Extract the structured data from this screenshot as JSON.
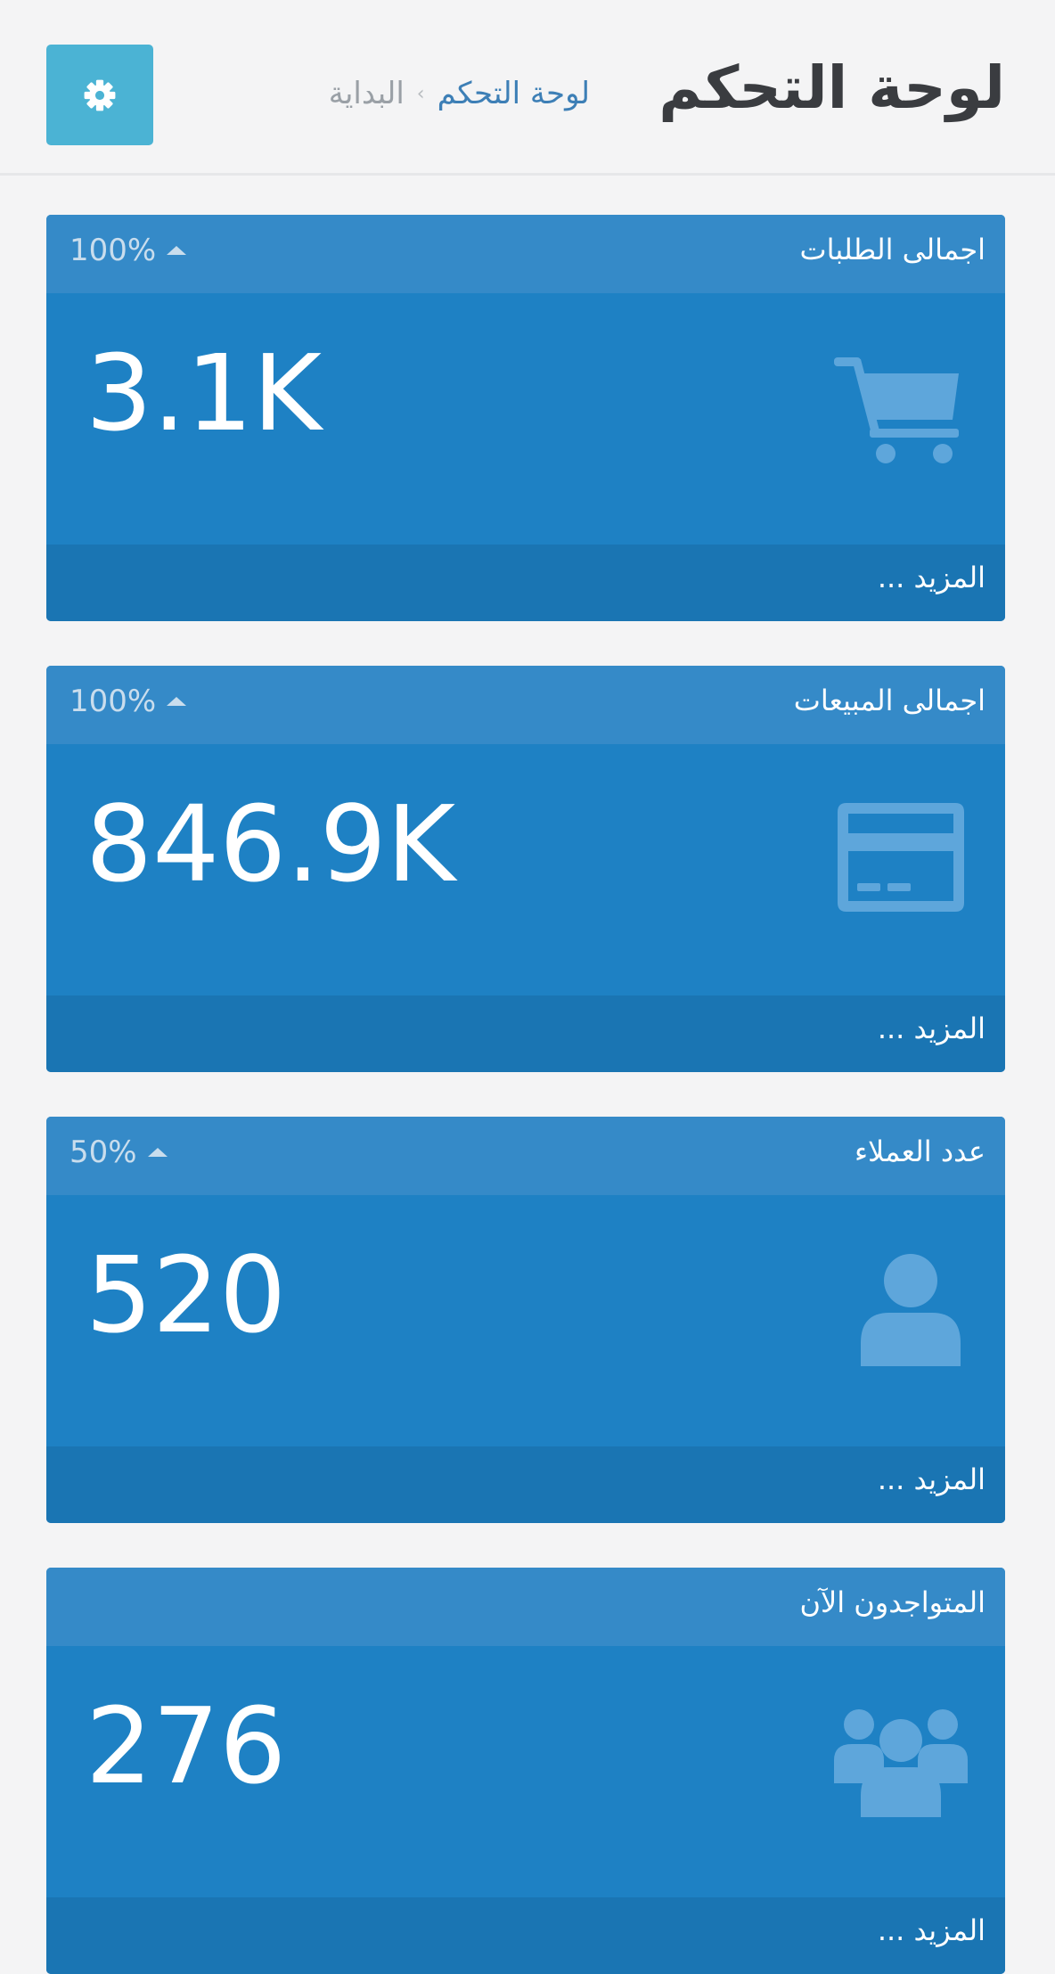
{
  "header": {
    "title": "لوحة التحكم",
    "breadcrumb": {
      "home": "البداية",
      "separator": "›",
      "current": "لوحة التحكم"
    },
    "settings_icon": "gear-icon"
  },
  "colors": {
    "page_background": "#f4f4f5",
    "accent_button": "#4bb3d4",
    "card_body": "#1e81c4",
    "card_header": "#358ac8",
    "card_footer": "#1a75b3",
    "title_text": "#3a3c40"
  },
  "cards": [
    {
      "title": "اجمالى الطلبات",
      "trend": "100%",
      "value": "3.1K",
      "icon": "shopping-cart-icon",
      "more": "المزيد ..."
    },
    {
      "title": "اجمالى المبيعات",
      "trend": "100%",
      "value": "846.9K",
      "icon": "credit-card-icon",
      "more": "المزيد ..."
    },
    {
      "title": "عدد العملاء",
      "trend": "50%",
      "value": "520",
      "icon": "user-icon",
      "more": "المزيد ..."
    },
    {
      "title": "المتواجدون الآن",
      "value": "276",
      "icon": "users-group-icon",
      "more": "المزيد ..."
    }
  ]
}
